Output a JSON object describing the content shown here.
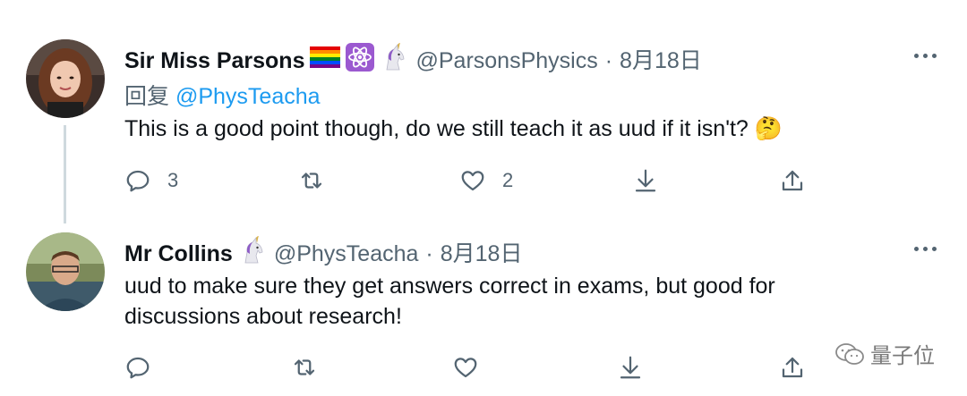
{
  "tweets": [
    {
      "name": "Sir Miss Parsons",
      "emojis": [
        "rainbow-flag-icon",
        "atom-symbol-icon",
        "unicorn-icon"
      ],
      "handle": "@ParsonsPhysics",
      "separator": "·",
      "date": "8月18日",
      "reply_prefix": "回复",
      "reply_handle": "@PhysTeacha",
      "text": "This is a good point though, do we still teach it as uud if it isn't? 🤔",
      "actions": {
        "reply_count": "3",
        "retweet_count": "",
        "like_count": "2"
      }
    },
    {
      "name": "Mr Collins",
      "emojis": [
        "unicorn-icon"
      ],
      "handle": "@PhysTeacha",
      "separator": "·",
      "date": "8月18日",
      "text_line1": "uud to make sure they get answers correct in exams, but good for",
      "text_line2": "discussions about research!",
      "actions": {
        "reply_count": "",
        "retweet_count": "",
        "like_count": ""
      }
    }
  ],
  "watermark": {
    "text": "量子位",
    "icon": "wechat-icon"
  },
  "colors": {
    "text": "#0f1419",
    "secondary": "#536471",
    "link": "#1d9bf0",
    "thread": "#cfd9de"
  }
}
